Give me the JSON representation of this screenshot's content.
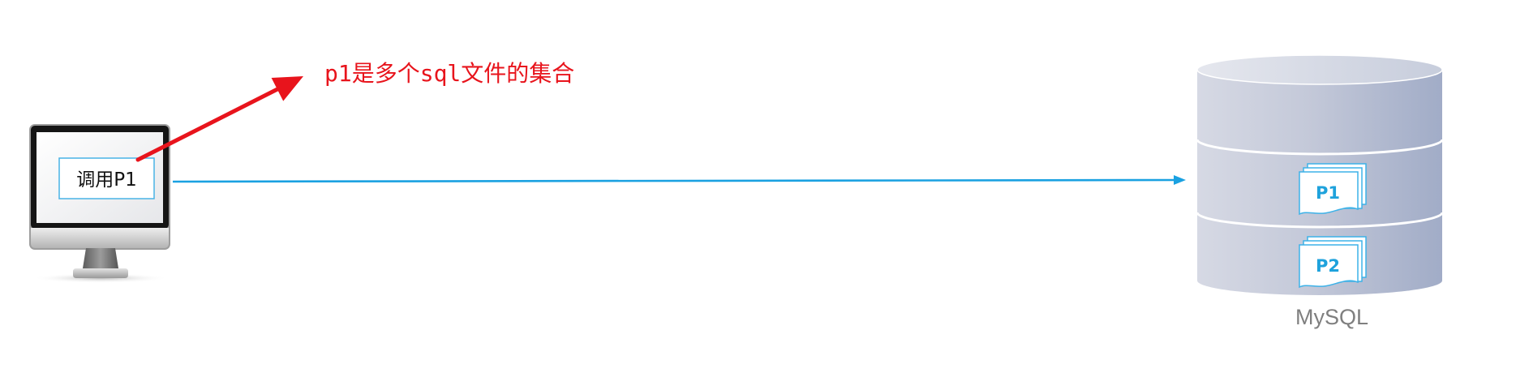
{
  "annotation": {
    "text": "p1是多个sql文件的集合",
    "color": "#e8141c"
  },
  "client": {
    "icon": "computer-monitor-icon",
    "call_label": "调用P1",
    "box_border_color": "#49b3e6"
  },
  "connector": {
    "color": "#1aa1e1"
  },
  "database": {
    "icon": "database-cylinder-icon",
    "label": "MySQL",
    "documents": [
      "P1",
      "P2"
    ],
    "document_icon": "document-stack-icon",
    "document_text_color": "#1ea2dc",
    "document_border_color": "#3db2e8"
  }
}
